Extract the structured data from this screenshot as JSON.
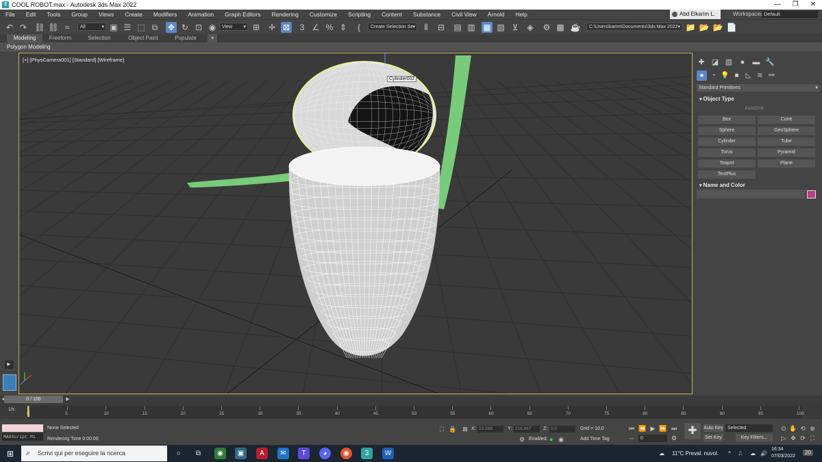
{
  "window": {
    "title": "COOL ROBOT.max - Autodesk 3ds Max 2022",
    "app_icon": "3",
    "controls": [
      "—",
      "❐",
      "✕"
    ]
  },
  "menu": {
    "items": [
      "File",
      "Edit",
      "Tools",
      "Group",
      "Views",
      "Create",
      "Modifiers",
      "Animation",
      "Graph Editors",
      "Rendering",
      "Customize",
      "Scripting",
      "Content",
      "Substance",
      "Civil View",
      "Arnold",
      "Help"
    ],
    "user": "Abd Elkarim L.",
    "workspaces_label": "Workspaces:",
    "workspace_value": "Default"
  },
  "toolbar": {
    "selection_filter": "All",
    "ref_coord": "View",
    "named_selection": "Create Selection Se",
    "project_path": "C:\\Users\\karim\\Documents\\3ds Max 2022"
  },
  "ribbon": {
    "tabs": [
      "Modeling",
      "Freeform",
      "Selection",
      "Object Paint",
      "Populate"
    ],
    "subpanel": "Polygon Modeling"
  },
  "viewport": {
    "label": "[+] [PhysCamera001] [Standard] [Wireframe]",
    "object_tag": "Cylinder002",
    "border_color": "#c8b25a",
    "selected_color": "#e8f08a",
    "limb_color": "#7fdc82"
  },
  "command_panel": {
    "category": "Standard Primitives",
    "object_type_title": "Object Type",
    "autogrid": "AutoGrid",
    "buttons": [
      "Box",
      "Cone",
      "Sphere",
      "GeoSphere",
      "Cylinder",
      "Tube",
      "Torus",
      "Pyramid",
      "Teapot",
      "Plane",
      "TextPlus"
    ],
    "name_color_title": "Name and Color",
    "swatch_color": "#c03a8c"
  },
  "timeline": {
    "frame_display": "0 / 100",
    "ticks": [
      "0",
      "5",
      "10",
      "15",
      "20",
      "25",
      "30",
      "35",
      "40",
      "45",
      "50",
      "55",
      "60",
      "65",
      "70",
      "75",
      "80",
      "85",
      "90",
      "95",
      "100"
    ],
    "current_frame_fraction": 0
  },
  "status": {
    "selection": "None Selected",
    "render_time": "Rendering Time  0:00:00",
    "maxscript_label": "MAXScript Mi",
    "x_label": "X:",
    "x_value": "53,589",
    "y_label": "Y:",
    "y_value": "216,967",
    "z_label": "Z:",
    "z_value": "0,0",
    "grid": "Grid = 10,0",
    "enabled_label": "Enabled:",
    "add_time_tag": "Add Time Tag",
    "frame_value": "0",
    "auto_key": "Auto Key",
    "set_key": "Set Key",
    "key_mode": "Selected",
    "key_filters": "Key Filters...",
    "frame_counter": "1/s"
  },
  "taskbar": {
    "search_placeholder": "Scrivi qui per eseguire la ricerca",
    "weather": "11°C  Preval. nuvol.",
    "time": "16:34",
    "date": "07/03/2022",
    "notification_count": "20"
  }
}
